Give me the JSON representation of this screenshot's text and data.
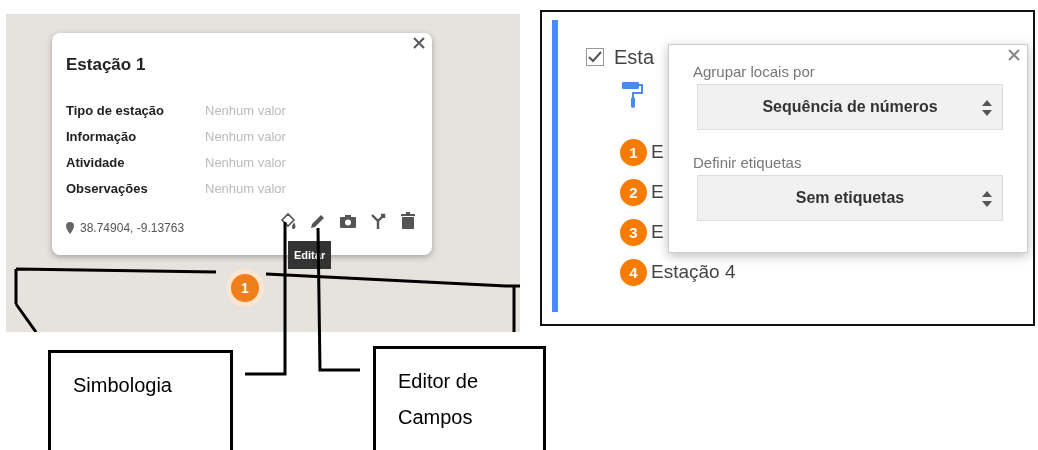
{
  "map_view": {
    "marker": "1",
    "popup": {
      "title": "Estação 1",
      "fields": [
        {
          "label": "Tipo de estação",
          "value": "Nenhum valor"
        },
        {
          "label": "Informação",
          "value": "Nenhum valor"
        },
        {
          "label": "Atividade",
          "value": "Nenhum valor"
        },
        {
          "label": "Observações",
          "value": "Nenhum valor"
        }
      ],
      "coordinates": "38.74904, -9.13763",
      "tooltip": "Editar"
    }
  },
  "layer_panel": {
    "layer": {
      "name": "Esta",
      "checked": true
    },
    "items": [
      {
        "number": "1",
        "name": "E"
      },
      {
        "number": "2",
        "name": "E"
      },
      {
        "number": "3",
        "name": "E"
      },
      {
        "number": "4",
        "name": "Estação 4"
      }
    ],
    "style_popover": {
      "fields": [
        {
          "label": "Agrupar locais por",
          "value": "Sequência de números"
        },
        {
          "label": "Definir etiquetas",
          "value": "Sem etiquetas"
        }
      ]
    }
  },
  "callouts": [
    "Simbologia",
    "Editor de Campos"
  ]
}
